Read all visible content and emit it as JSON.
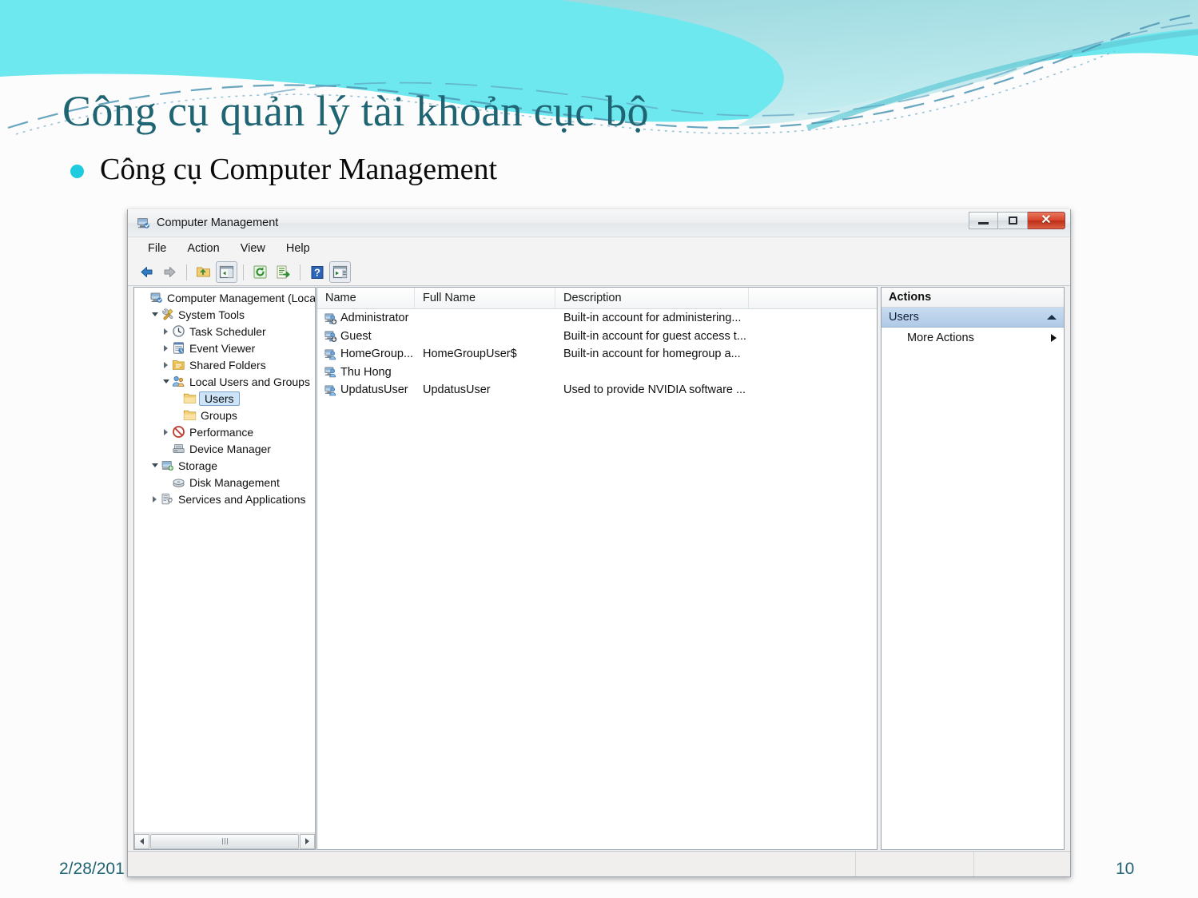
{
  "slide": {
    "title": "Công cụ quản lý tài khoản cục bộ",
    "bullet": "Công cụ Computer Management",
    "footer_date": "2/28/201",
    "page_number": "10",
    "accent_color": "#1F6472",
    "bullet_color": "#1FCBDE",
    "header_band_color": "#6EE8EF"
  },
  "window": {
    "title": "Computer Management",
    "icon": "computer-management-icon",
    "buttons": {
      "minimize": "Minimize",
      "maximize": "Maximize",
      "close": "Close"
    },
    "menu": [
      "File",
      "Action",
      "View",
      "Help"
    ],
    "toolbar": [
      {
        "name": "back-icon",
        "label": "Back"
      },
      {
        "name": "forward-icon",
        "label": "Forward"
      },
      {
        "name": "up-folder-icon",
        "label": "Up One Level"
      },
      {
        "name": "show-hide-tree-icon",
        "label": "Show/Hide Console Tree"
      },
      {
        "name": "refresh-icon",
        "label": "Refresh"
      },
      {
        "name": "export-list-icon",
        "label": "Export List"
      },
      {
        "name": "help-icon",
        "label": "Help"
      },
      {
        "name": "show-action-pane-icon",
        "label": "Show/Hide Action Pane"
      }
    ],
    "tree": [
      {
        "label": "Computer Management (Local",
        "depth": 0,
        "twisty": "none",
        "icon": "computer-icon",
        "selected": false
      },
      {
        "label": "System Tools",
        "depth": 1,
        "twisty": "expanded",
        "icon": "system-tools-icon",
        "selected": false
      },
      {
        "label": "Task Scheduler",
        "depth": 2,
        "twisty": "collapsed",
        "icon": "clock-icon",
        "selected": false
      },
      {
        "label": "Event Viewer",
        "depth": 2,
        "twisty": "collapsed",
        "icon": "event-viewer-icon",
        "selected": false
      },
      {
        "label": "Shared Folders",
        "depth": 2,
        "twisty": "collapsed",
        "icon": "shared-folders-icon",
        "selected": false
      },
      {
        "label": "Local Users and Groups",
        "depth": 2,
        "twisty": "expanded",
        "icon": "users-groups-icon",
        "selected": false
      },
      {
        "label": "Users",
        "depth": 3,
        "twisty": "none",
        "icon": "folder-icon",
        "selected": true
      },
      {
        "label": "Groups",
        "depth": 3,
        "twisty": "none",
        "icon": "folder-icon",
        "selected": false
      },
      {
        "label": "Performance",
        "depth": 2,
        "twisty": "collapsed",
        "icon": "performance-icon",
        "selected": false
      },
      {
        "label": "Device Manager",
        "depth": 2,
        "twisty": "none",
        "icon": "device-manager-icon",
        "selected": false
      },
      {
        "label": "Storage",
        "depth": 1,
        "twisty": "expanded",
        "icon": "storage-icon",
        "selected": false
      },
      {
        "label": "Disk Management",
        "depth": 2,
        "twisty": "none",
        "icon": "disk-management-icon",
        "selected": false
      },
      {
        "label": "Services and Applications",
        "depth": 1,
        "twisty": "collapsed",
        "icon": "services-icon",
        "selected": false
      }
    ],
    "list": {
      "columns": [
        "Name",
        "Full Name",
        "Description",
        ""
      ],
      "rows": [
        {
          "icon": "user-disabled-icon",
          "name": "Administrator",
          "full_name": "",
          "description": "Built-in account for administering..."
        },
        {
          "icon": "user-disabled-icon",
          "name": "Guest",
          "full_name": "",
          "description": "Built-in account for guest access t..."
        },
        {
          "icon": "user-icon",
          "name": "HomeGroup...",
          "full_name": "HomeGroupUser$",
          "description": "Built-in account for homegroup a..."
        },
        {
          "icon": "user-icon",
          "name": "Thu Hong",
          "full_name": "",
          "description": ""
        },
        {
          "icon": "user-icon",
          "name": "UpdatusUser",
          "full_name": "UpdatusUser",
          "description": "Used to provide NVIDIA software ..."
        }
      ]
    },
    "actions": {
      "title": "Actions",
      "group": "Users",
      "items": [
        "More Actions"
      ]
    },
    "statusbar": ""
  }
}
